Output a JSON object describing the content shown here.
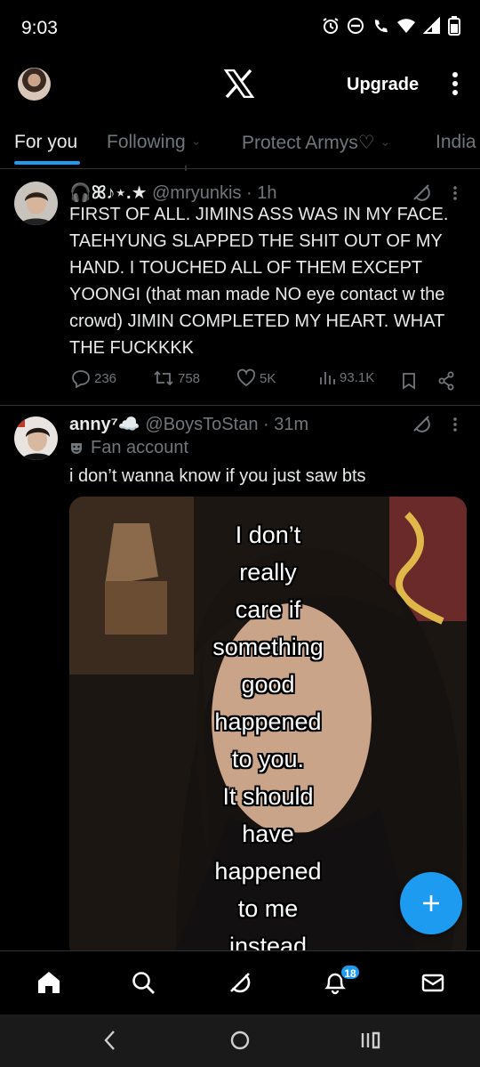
{
  "status": {
    "time": "9:03"
  },
  "header": {
    "upgrade_label": "Upgrade"
  },
  "tabs": [
    {
      "label": "For you"
    },
    {
      "label": "Following"
    },
    {
      "label": "Protect Armys♡"
    },
    {
      "label": "India"
    }
  ],
  "posts": [
    {
      "display_name": "🎧ꕤ♪⋆.★",
      "handle": "@mryunkis",
      "sep": " · ",
      "time": "1h",
      "text": "FIRST OF ALL. JIMINS ASS WAS IN MY FACE. TAEHYUNG SLAPPED THE SHIT OUT OF MY HAND. I TOUCHED ALL OF THEM EXCEPT YOONGI (that man made NO eye contact w the crowd) JIMIN COMPLETED MY HEART. WHAT THE FUCKKKK",
      "replies": "236",
      "reposts": "758",
      "likes": "5K",
      "views": "93.1K"
    },
    {
      "display_name": "anny⁷☁️",
      "handle": "@BoysToStan",
      "sep": " · ",
      "time": "31m",
      "label": "Fan account",
      "text": "i don’t wanna know if you just saw bts",
      "media_caption": [
        "I don’t",
        "really",
        "care if",
        "something",
        "good",
        "happened",
        "to you.",
        "It should",
        "have",
        "happened",
        "to me",
        "instead"
      ]
    }
  ],
  "notifications_badge": "18",
  "colors": {
    "accent": "#1d9bf0",
    "background": "#000000",
    "muted": "#71767b",
    "text": "#e7e9ea"
  }
}
